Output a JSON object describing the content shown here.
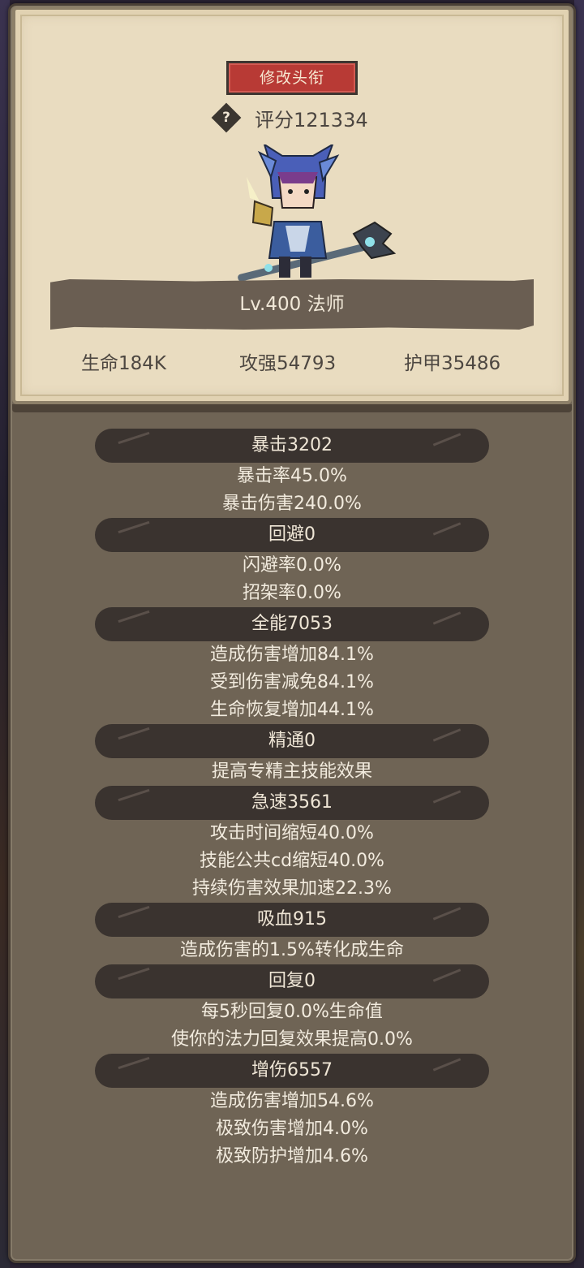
{
  "header": {
    "rename_label": "修改头衔",
    "help_glyph": "?",
    "score_text": "评分121334",
    "level_text": "Lv.400 法师"
  },
  "basic_stats": [
    {
      "text": "生命184K"
    },
    {
      "text": "攻强54793"
    },
    {
      "text": "护甲35486"
    }
  ],
  "sections": [
    {
      "title": "暴击3202",
      "lines": [
        "暴击率45.0%",
        "暴击伤害240.0%"
      ]
    },
    {
      "title": "回避0",
      "lines": [
        "闪避率0.0%",
        "招架率0.0%"
      ]
    },
    {
      "title": "全能7053",
      "lines": [
        "造成伤害增加84.1%",
        "受到伤害减免84.1%",
        "生命恢复增加44.1%"
      ]
    },
    {
      "title": "精通0",
      "lines": [
        "提高专精主技能效果"
      ]
    },
    {
      "title": "急速3561",
      "lines": [
        "攻击时间缩短40.0%",
        "技能公共cd缩短40.0%",
        "持续伤害效果加速22.3%"
      ]
    },
    {
      "title": "吸血915",
      "lines": [
        "造成伤害的1.5%转化成生命"
      ]
    },
    {
      "title": "回复0",
      "lines": [
        "每5秒回复0.0%生命值",
        "使你的法力回复效果提高0.0%"
      ]
    },
    {
      "title": "增伤6557",
      "lines": [
        "造成伤害增加54.6%",
        "极致伤害增加4.0%",
        "极致防护增加4.6%"
      ]
    }
  ],
  "colors": {
    "panel_bg": "#6f6455",
    "card_bg": "#e9dcc0",
    "button_red": "#b83a35",
    "section_bar": "#3a332f"
  }
}
